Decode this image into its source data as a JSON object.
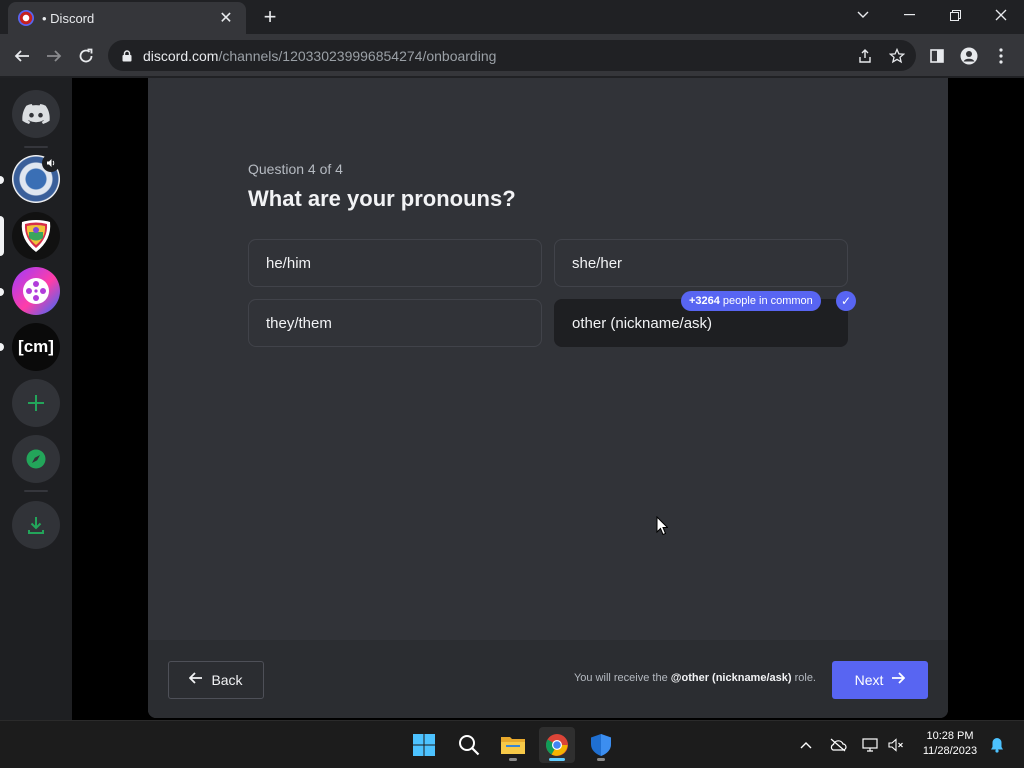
{
  "browser": {
    "tab_title": "• Discord",
    "tab_close": "✕",
    "new_tab": "+",
    "url_host": "discord.com",
    "url_path": "/channels/1203302399968542 74/onboarding"
  },
  "guilds": {
    "cm_label": "[cm]",
    "add_label": "+"
  },
  "onboarding": {
    "question_count": "Question 4 of 4",
    "title": "What are your pronouns?",
    "options": [
      {
        "label": "he/him",
        "selected": false
      },
      {
        "label": "she/her",
        "selected": false
      },
      {
        "label": "they/them",
        "selected": false
      },
      {
        "label": "other (nickname/ask)",
        "selected": true
      }
    ],
    "common_count": "+3264",
    "common_text": "people in common",
    "checkmark": "✓"
  },
  "footer": {
    "back_label": "Back",
    "note_prefix": "You will receive the",
    "note_role": "@other (nickname/ask)",
    "note_suffix": "role.",
    "next_label": "Next",
    "accent_color": "#5865f2"
  },
  "taskbar": {
    "time": "10:28 PM",
    "date": "11/28/2023"
  }
}
